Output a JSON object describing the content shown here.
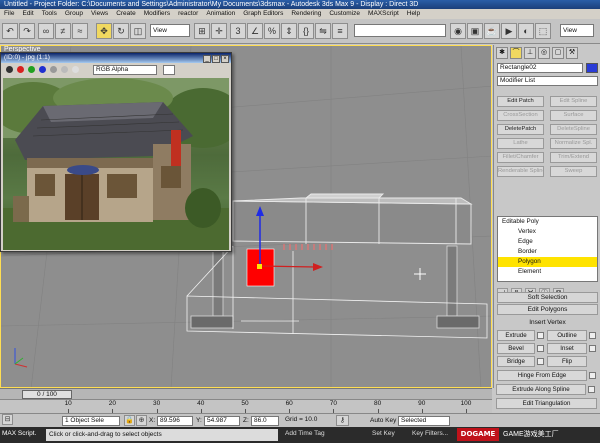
{
  "window": {
    "title": "Untitled - Project Folder: C:\\Documents and Settings\\Administrator\\My Documents\\3dsmax - Autodesk 3ds Max 9 - Display : Direct 3D"
  },
  "menu": [
    "File",
    "Edit",
    "Tools",
    "Group",
    "Views",
    "Create",
    "Modifiers",
    "reactor",
    "Animation",
    "Graph Editors",
    "Rendering",
    "Customize",
    "MAXScript",
    "Help"
  ],
  "toolbar": {
    "refcoord": "View",
    "named_sel": "",
    "right_view": "View"
  },
  "viewport": {
    "label": "Perspective"
  },
  "render_window": {
    "title": "(ID:0) - jpg (1:1)",
    "channel": "RGB Alpha",
    "buttons": [
      "_",
      "□",
      "×"
    ]
  },
  "command_panel": {
    "object_name": "Rectangle02",
    "modifier_list": "Modifier List",
    "buttons": [
      {
        "label": "Edit Patch",
        "enabled": true
      },
      {
        "label": "Edit Spline",
        "enabled": false
      },
      {
        "label": "CrossSection",
        "enabled": false
      },
      {
        "label": "Surface",
        "enabled": false
      },
      {
        "label": "DeletePatch",
        "enabled": true
      },
      {
        "label": "DeleteSpline",
        "enabled": false
      },
      {
        "label": "Lathe",
        "enabled": false
      },
      {
        "label": "Normalize Spl.",
        "enabled": false
      },
      {
        "label": "Fillet/Chamfer",
        "enabled": false
      },
      {
        "label": "Trim/Extend",
        "enabled": false
      },
      {
        "label": "Renderable Spline",
        "enabled": false
      },
      {
        "label": "Sweep",
        "enabled": false
      }
    ],
    "stack": [
      {
        "label": "Editable Poly",
        "sub": false,
        "selected": false
      },
      {
        "label": "Vertex",
        "sub": true,
        "selected": false
      },
      {
        "label": "Edge",
        "sub": true,
        "selected": false
      },
      {
        "label": "Border",
        "sub": true,
        "selected": false
      },
      {
        "label": "Polygon",
        "sub": true,
        "selected": true
      },
      {
        "label": "Element",
        "sub": true,
        "selected": false
      }
    ],
    "soft_selection": "Soft Selection",
    "edit_polygons": "Edit Polygons",
    "insert_vertex": "Insert Vertex",
    "ops": [
      [
        "Extrude",
        "Outline"
      ],
      [
        "Bevel",
        "Inset"
      ],
      [
        "Bridge",
        "Flip"
      ]
    ],
    "hinge": "Hinge From Edge",
    "extrude_spline": "Extrude Along Spline",
    "edit_triangulation": "Edit Triangulation"
  },
  "timeline": {
    "slider": "0 / 100",
    "ticks": [
      10,
      20,
      30,
      40,
      50,
      60,
      70,
      80,
      90,
      100
    ]
  },
  "status": {
    "selection": "1 Object Sele",
    "x_label": "X:",
    "x": "89.596",
    "y_label": "Y:",
    "y": "54.987",
    "z_label": "Z:",
    "z": "86.0",
    "grid": "Grid = 10.0",
    "autokey": "Auto Key",
    "autokey_mode": "Selected",
    "setkey": "Set Key",
    "keyfilters": "Key Filters...",
    "add_time_tag": "Add Time Tag"
  },
  "prompt": {
    "maxscript": "MAX Script.",
    "text": "Click or click-and-drag to select objects"
  },
  "watermark": {
    "brand": "DOGAME",
    "site": "GAME游戏美工厂"
  },
  "colors": {
    "selected_poly": "#ff0000",
    "highlight": "#ffe300",
    "viewport_bg": "#8e8e8e",
    "object_color": "#2a3cd6"
  }
}
